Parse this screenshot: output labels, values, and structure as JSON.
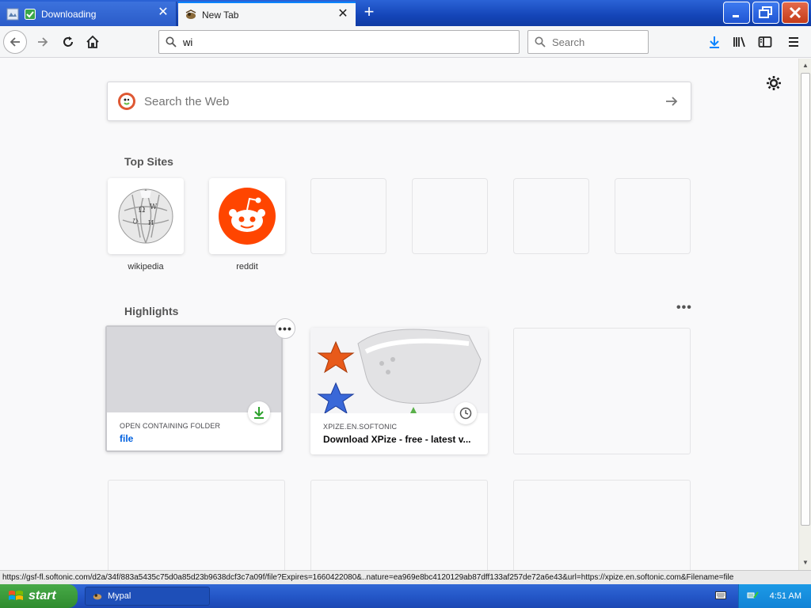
{
  "tabs": [
    {
      "title": "Downloading",
      "active": false
    },
    {
      "title": "New Tab",
      "active": true
    }
  ],
  "window_controls": {
    "minimize": "_",
    "maximize": "❐",
    "close": "✕"
  },
  "navbar": {
    "url_value": "wi",
    "search_placeholder": "Search"
  },
  "newtab": {
    "web_search_placeholder": "Search the Web",
    "top_sites_title": "Top Sites",
    "top_sites": [
      {
        "label": "wikipedia",
        "icon": "wikipedia-globe-icon"
      },
      {
        "label": "reddit",
        "icon": "reddit-alien-icon"
      },
      {
        "label": "",
        "icon": ""
      },
      {
        "label": "",
        "icon": ""
      },
      {
        "label": "",
        "icon": ""
      },
      {
        "label": "",
        "icon": ""
      }
    ],
    "highlights_title": "Highlights",
    "highlights_menu": "•••",
    "highlights": [
      {
        "meta": "OPEN CONTAINING FOLDER",
        "title": "file",
        "badge": "download-icon"
      },
      {
        "meta": "XPIZE.EN.SOFTONIC",
        "title": "Download XPize - free - latest v...",
        "badge": "clock-icon"
      }
    ]
  },
  "status_url": "https://gsf-fl.softonic.com/d2a/34f/883a5435c75d0a85d23b9638dcf3c7a09f/file?Expires=1660422080&..nature=ea969e8bc4120129ab87dff133af257de72a6e43&url=https://xpize.en.softonic.com&Filename=file",
  "taskbar": {
    "start_label": "start",
    "task_label": "Mypal",
    "clock": "4:51 AM"
  },
  "colors": {
    "accent": "#0a84ff",
    "download_green": "#2ba12b",
    "reddit_orange": "#ff4500",
    "link_blue": "#0060df"
  }
}
